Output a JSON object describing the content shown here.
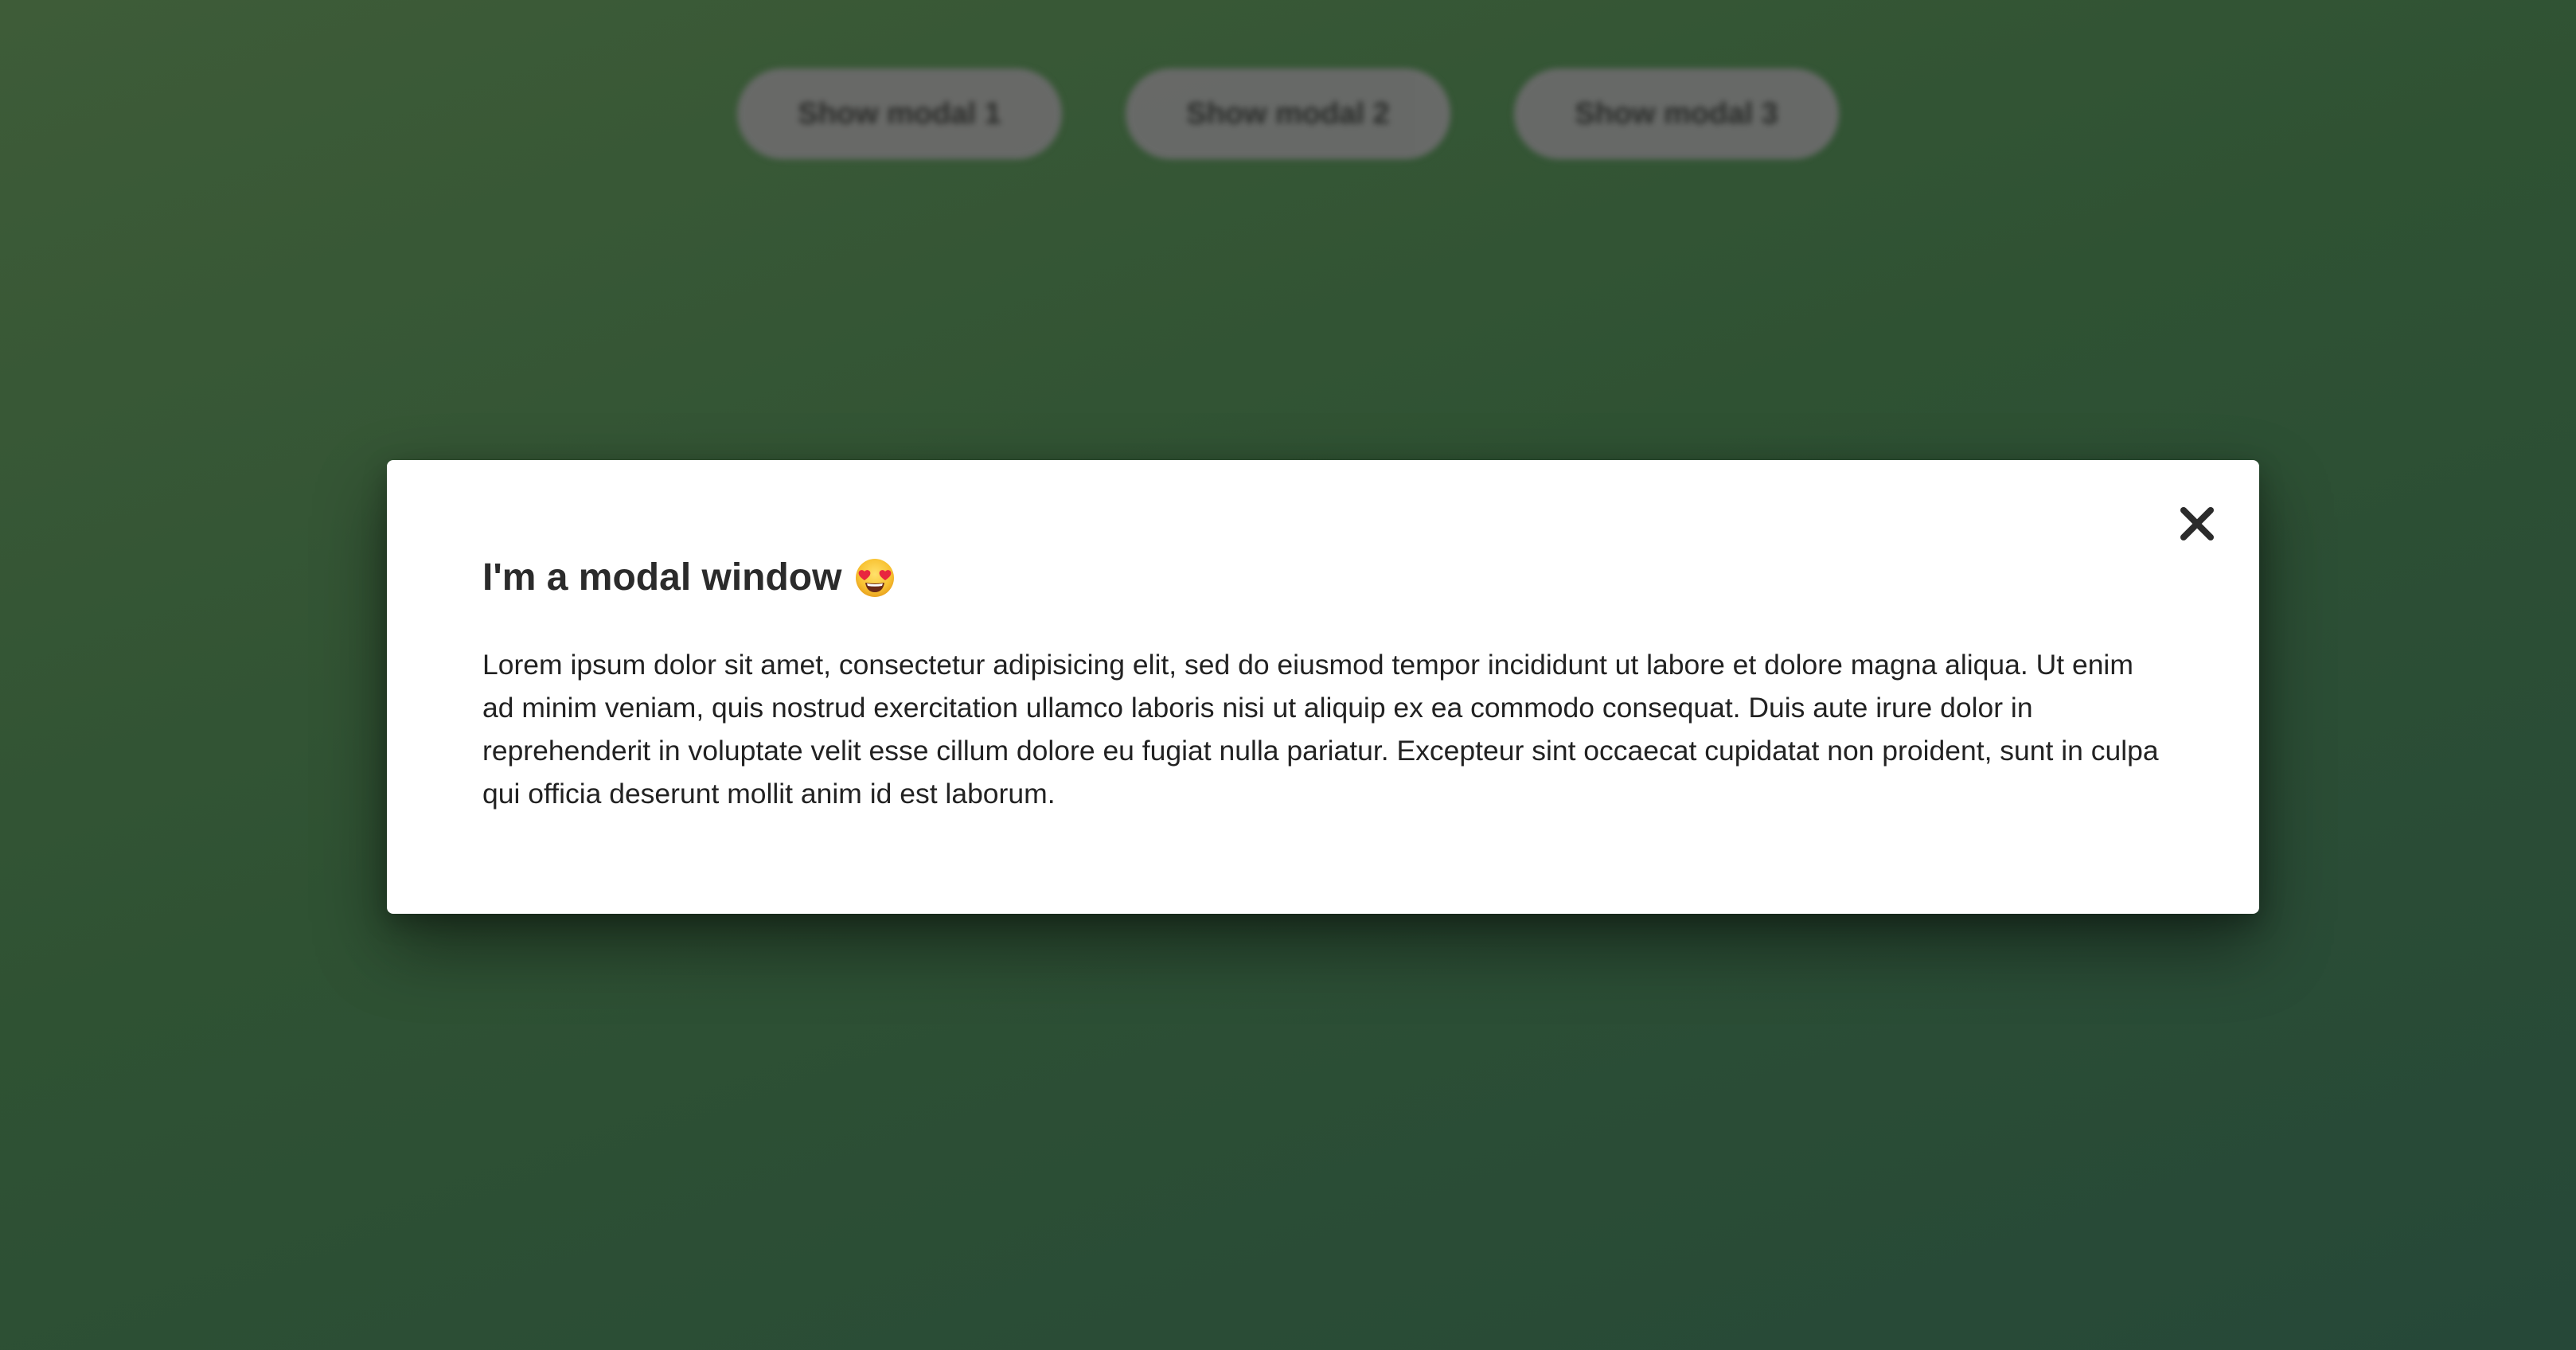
{
  "background": {
    "buttons": [
      {
        "label": "Show modal 1"
      },
      {
        "label": "Show modal 2"
      },
      {
        "label": "Show modal 3"
      }
    ]
  },
  "modal": {
    "title": "I'm a modal window",
    "title_emoji": "smiling-face-heart-eyes-icon",
    "body": "Lorem ipsum dolor sit amet, consectetur adipisicing elit, sed do eiusmod tempor incididunt ut labore et dolore magna aliqua. Ut enim ad minim veniam, quis nostrud exercitation ullamco laboris nisi ut aliquip ex ea commodo consequat. Duis aute irure dolor in reprehenderit in voluptate velit esse cillum dolore eu fugiat nulla pariatur. Excepteur sint occaecat cupidatat non proident, sunt in culpa qui officia deserunt mollit anim id est laborum.",
    "close_icon": "close-icon"
  },
  "colors": {
    "background_gradient_start": "#3e5c38",
    "background_gradient_end": "#264838",
    "modal_background": "#ffffff",
    "text": "#222222",
    "button_background": "#6b6b6b"
  }
}
